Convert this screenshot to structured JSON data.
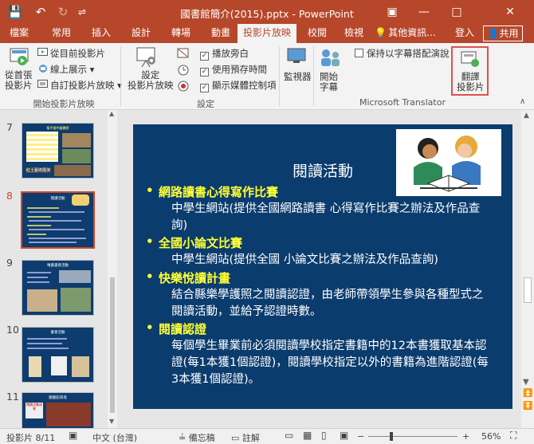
{
  "window": {
    "title": "國書館簡介(2015).pptx - PowerPoint",
    "minimize": "—",
    "restore": "□",
    "close": "✕",
    "ribbon_display": "▣"
  },
  "qat": {
    "save": "💾",
    "undo": "↶",
    "redo": "↻",
    "more": "⇌"
  },
  "tabs": [
    {
      "label": "檔案"
    },
    {
      "label": "常用"
    },
    {
      "label": "插入"
    },
    {
      "label": "設計"
    },
    {
      "label": "轉場"
    },
    {
      "label": "動畫"
    },
    {
      "label": "投影片放映"
    },
    {
      "label": "校閱"
    },
    {
      "label": "檢視"
    },
    {
      "label": "其他資訊..."
    }
  ],
  "account": {
    "signin": "登入",
    "share": "共用"
  },
  "ribbon": {
    "group1": {
      "from_beginning": "從首張\n投影片",
      "from_current": "從目前投影片",
      "online_present": "線上展示 ▾",
      "custom_show": "自訂投影片放映 ▾",
      "label": "開始投影片放映"
    },
    "group2": {
      "setup_show": "設定\n投影片放映",
      "hide_slide_icon": "hide-slide",
      "play_narrations": "播放旁白",
      "use_timings": "使用預存時間",
      "show_media_controls": "顯示媒體控制項",
      "label": "設定"
    },
    "monitor": "監視器",
    "start_subtitles": "開始\n字幕",
    "keep_subtitles": "保持以字幕搭配演說",
    "translate": "翻譯\n投影片",
    "translator_label": "Microsoft Translator"
  },
  "thumbnails": [
    {
      "number": "7",
      "title": "龍平國中圖書館",
      "caption": "紅土藝術展演"
    },
    {
      "number": "8",
      "title": "閱讀活動"
    },
    {
      "number": "9",
      "title": "唯書書香活動"
    },
    {
      "number": "10",
      "title": "書香活動"
    },
    {
      "number": "11",
      "title": "圖書館環境",
      "caption": "閱讀活動成果"
    }
  ],
  "slide": {
    "title": "閱讀活動",
    "items": [
      {
        "heading": "網路讀書心得寫作比賽",
        "text": "中學生網站(提供全國網路讀書 心得寫作比賽之辦法及作品查詢)"
      },
      {
        "heading": "全國小論文比賽",
        "text": "中學生網站(提供全國 小論文比賽之辦法及作品查詢)"
      },
      {
        "heading": "快樂悅讀計畫",
        "text": "結合縣樂學護照之閱讀認證，由老師帶領學生參與各種型式之閱讀活動，並給予認證時數。"
      },
      {
        "heading": "閱讀認證",
        "text": "每個學生畢業前必須閱讀學校指定書籍中的12本書獲取基本認證(每1本獲1個認證)，閱讀學校指定以外的書籍為進階認證(每3本獲1個認證)。"
      }
    ]
  },
  "status": {
    "slide_pos": "投影片 8/11",
    "language": "中文 (台灣)",
    "notes": "備忘稿",
    "comments": "註解",
    "zoom": "56%",
    "zoom_value": 0.56
  },
  "colors": {
    "accent": "#b7472a",
    "slide_bg": "#0b3c6e",
    "heading": "#ffff33"
  }
}
